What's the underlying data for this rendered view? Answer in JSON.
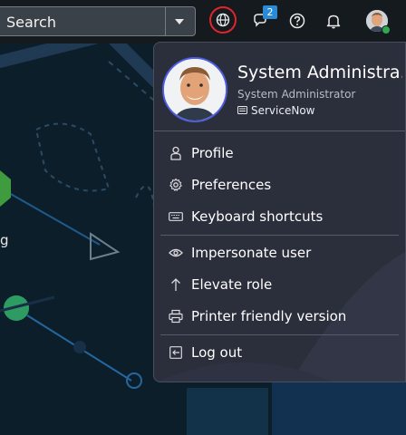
{
  "header": {
    "search_placeholder": "Search",
    "chat_badge_count": "2"
  },
  "profile": {
    "name": "System Administra…",
    "role": "System Administrator",
    "instance": "ServiceNow"
  },
  "menu": {
    "profile": "Profile",
    "preferences": "Preferences",
    "keyboard_shortcuts": "Keyboard shortcuts",
    "impersonate_user": "Impersonate user",
    "elevate_role": "Elevate role",
    "printer_friendly": "Printer friendly version",
    "log_out": "Log out"
  },
  "background": {
    "partial_text": "g"
  },
  "colors": {
    "globe_ring": "#e3252b",
    "badge": "#2b8ad8",
    "avatar_ring": "#4d5fe0",
    "online": "#32a852",
    "menu_bg": "#2b2e3b"
  },
  "icons": {
    "header": [
      "globe-icon",
      "chat-icon",
      "help-icon",
      "bell-icon"
    ],
    "menu": [
      "person-icon",
      "gear-icon",
      "keyboard-icon",
      "eye-icon",
      "arrow-up-icon",
      "printer-icon",
      "logout-icon"
    ]
  }
}
